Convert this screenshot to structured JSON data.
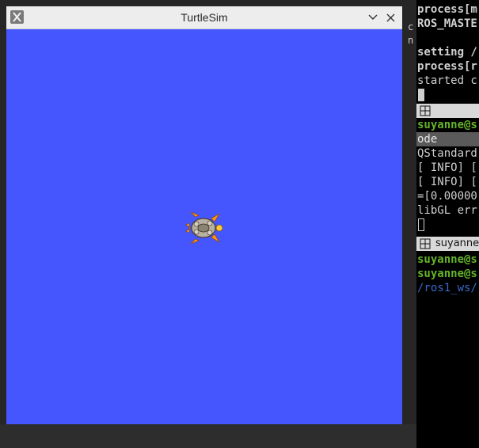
{
  "window": {
    "title": "TurtleSim",
    "icons": {
      "app": "x-window-icon",
      "minimize": "chevron-down-icon",
      "close": "close-icon"
    }
  },
  "background": {
    "caption_fragment": "...",
    "side_fragments": [
      "c",
      "n"
    ]
  },
  "terminal": {
    "lines_top": [
      "process[m",
      "ROS_MASTE",
      "setting /",
      "process[r",
      "started c"
    ],
    "tab1": {
      "label": ""
    },
    "prompt_user": "suyanne@s",
    "highlight_line": "ode",
    "lines_mid": [
      "QStandard",
      "[ INFO] [",
      "[ INFO] [",
      "=[0.00000",
      "libGL err"
    ],
    "tab2": {
      "label": "suyanne"
    },
    "lines_bottom": [
      "suyanne@s",
      "suyanne@s",
      "/ros1_ws/"
    ]
  },
  "colors": {
    "canvas": "#4556ff",
    "terminal_bg": "#000000",
    "prompt_green": "#66b32a",
    "path_blue": "#3a68c8"
  }
}
